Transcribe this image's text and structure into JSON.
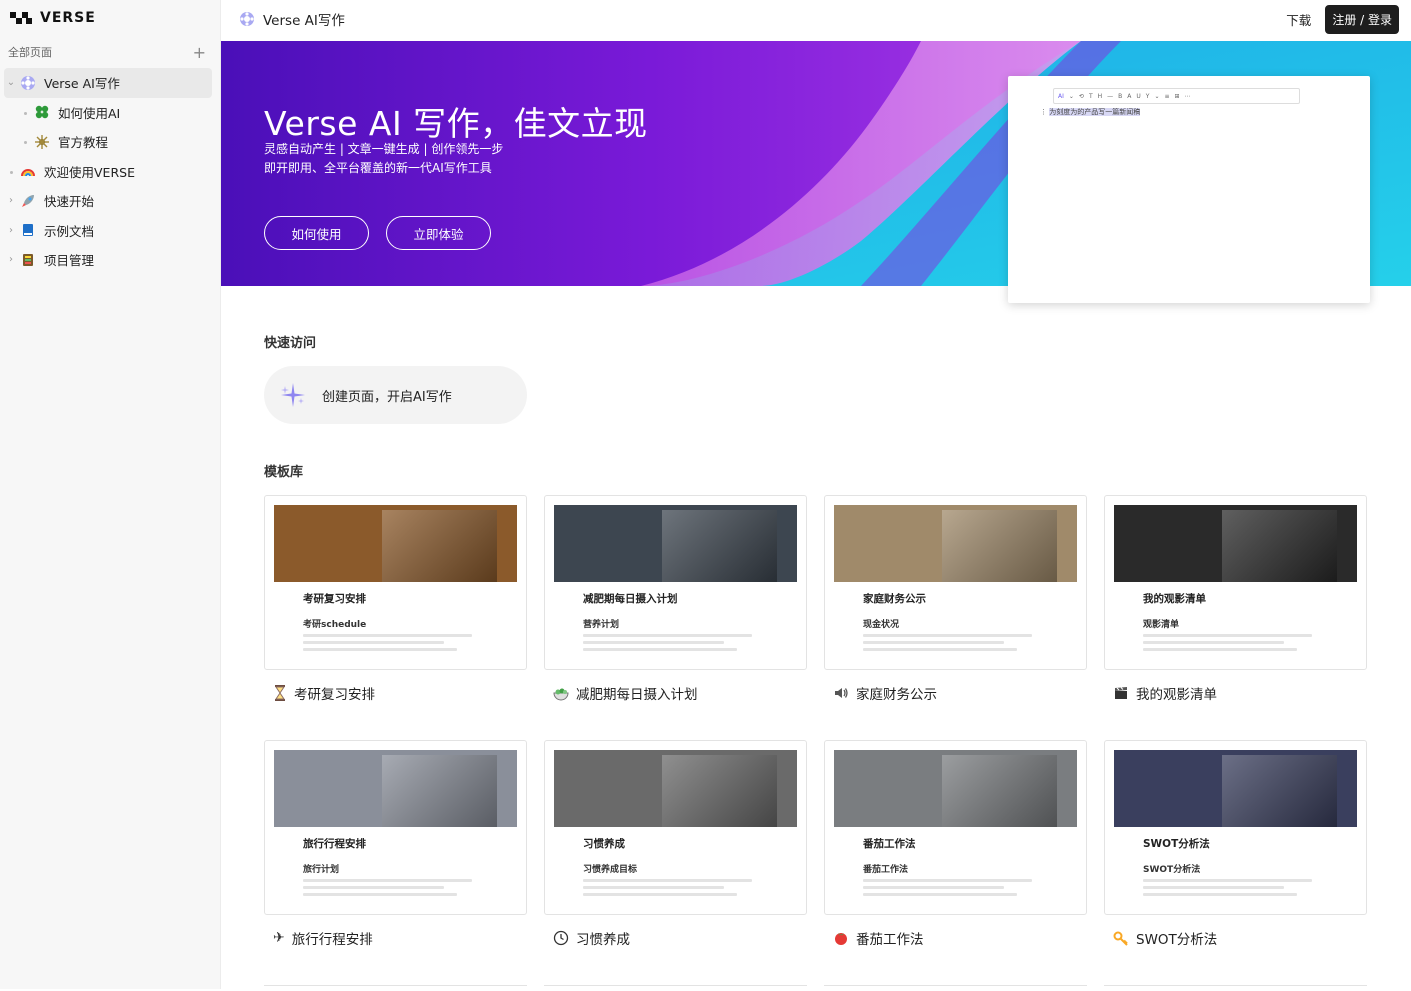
{
  "brand": {
    "name": "VERSE"
  },
  "sidebar": {
    "section_label": "全部页面",
    "add_icon": "plus-icon",
    "items": [
      {
        "label": "Verse AI写作",
        "icon": "ai-logo-icon",
        "active": true,
        "expanded": true
      },
      {
        "label": "如何使用AI",
        "icon": "clover-icon",
        "child": true
      },
      {
        "label": "官方教程",
        "icon": "sparkle-icon",
        "child": true
      },
      {
        "label": "欢迎使用VERSE",
        "icon": "rainbow-icon"
      },
      {
        "label": "快速开始",
        "icon": "rocket-icon"
      },
      {
        "label": "示例文档",
        "icon": "book-icon"
      },
      {
        "label": "项目管理",
        "icon": "ledger-icon"
      }
    ]
  },
  "topbar": {
    "page_title": "Verse AI写作",
    "download": "下载",
    "login": "注册 / 登录"
  },
  "hero": {
    "title": "Verse AI 写作，佳文立现",
    "subtitle1": "灵感自动产生 | 文章一键生成 | 创作领先一步",
    "subtitle2": "即开即用、全平台覆盖的新一代AI写作工具",
    "btn_how": "如何使用",
    "btn_try": "立即体验",
    "editor_toolbar": "AI",
    "editor_line": "为刻度为的产品写一篇新闻稿"
  },
  "quick_access": {
    "title": "快速访问",
    "card_label": "创建页面，开启AI写作"
  },
  "templates": {
    "title": "模板库",
    "items": [
      {
        "caption": "考研复习安排",
        "icon": "hourglass-icon",
        "doc_title": "考研复习安排",
        "doc_sub": "考研schedule",
        "cover_color": "#8b5a2b"
      },
      {
        "caption": "减肥期每日摄入计划",
        "icon": "salad-icon",
        "doc_title": "减肥期每日摄入计划",
        "doc_sub": "营养计划",
        "cover_color": "#3d4650"
      },
      {
        "caption": "家庭财务公示",
        "icon": "speaker-icon",
        "doc_title": "家庭财务公示",
        "doc_sub": "现金状况",
        "cover_color": "#a08a6a"
      },
      {
        "caption": "我的观影清单",
        "icon": "clapper-icon",
        "doc_title": "我的观影清单",
        "doc_sub": "观影清单",
        "cover_color": "#2a2a2a"
      },
      {
        "caption": "旅行行程安排",
        "icon": "airplane-icon",
        "doc_title": "旅行行程安排",
        "doc_sub": "旅行计划",
        "cover_color": "#8a8f9a"
      },
      {
        "caption": "习惯养成",
        "icon": "clock-icon",
        "doc_title": "习惯养成",
        "doc_sub": "习惯养成目标",
        "cover_color": "#6a6a6a"
      },
      {
        "caption": "番茄工作法",
        "icon": "tomato-icon",
        "doc_title": "番茄工作法",
        "doc_sub": "番茄工作法",
        "cover_color": "#7a7d80"
      },
      {
        "caption": "SWOT分析法",
        "icon": "key-icon",
        "doc_title": "SWOT分析法",
        "doc_sub": "SWOT分析法",
        "cover_color": "#3a3f5e"
      }
    ]
  }
}
